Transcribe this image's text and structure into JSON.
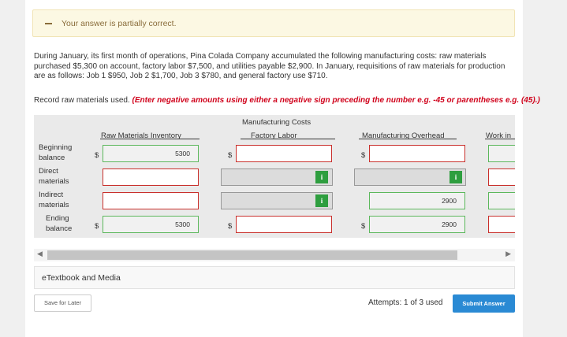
{
  "alert": {
    "message": "Your answer is partially correct.",
    "color": "#8a6d3b"
  },
  "question": {
    "text": "During January, its first month of operations, Pina Colada Company accumulated the following manufacturing costs: raw materials purchased $5,300 on account, factory labor $7,500, and utilities payable $2,900. In January, requisitions of raw materials for production are as follows: Job 1 $950, Job 2 $1,700, Job 3 $780, and general factory use $710."
  },
  "instruction": {
    "text": "Record raw materials used.",
    "note": "(Enter negative amounts using either a negative sign preceding the number e.g. -45 or parentheses e.g. (45).)",
    "note_color": "#d0021b"
  },
  "table": {
    "group_header": "Manufacturing Costs",
    "columns": {
      "raw_materials": "Raw Materials Inventory",
      "factory_labor": "Factory Labor",
      "overhead": "Manufacturing Overhead",
      "work_in_process": "Work in"
    },
    "rows": {
      "beginning": "Beginning balance",
      "direct": "Direct materials",
      "indirect": "Indirect materials",
      "ending": "Ending balance"
    },
    "currency": "$",
    "values": {
      "raw_beginning": "5300",
      "raw_ending": "5300",
      "overhead_indirect": "2900",
      "overhead_ending": "2900"
    },
    "info_icon": "i"
  },
  "etextbook": "eTextbook and Media",
  "save_button": "Save for Later",
  "attempts": "Attempts: 1 of 3 used",
  "submit_button": "Submit Answer",
  "colors": {
    "error_border": "#c9302c",
    "correct_border": "#5cb85c",
    "submit": "#2a8ad4"
  }
}
